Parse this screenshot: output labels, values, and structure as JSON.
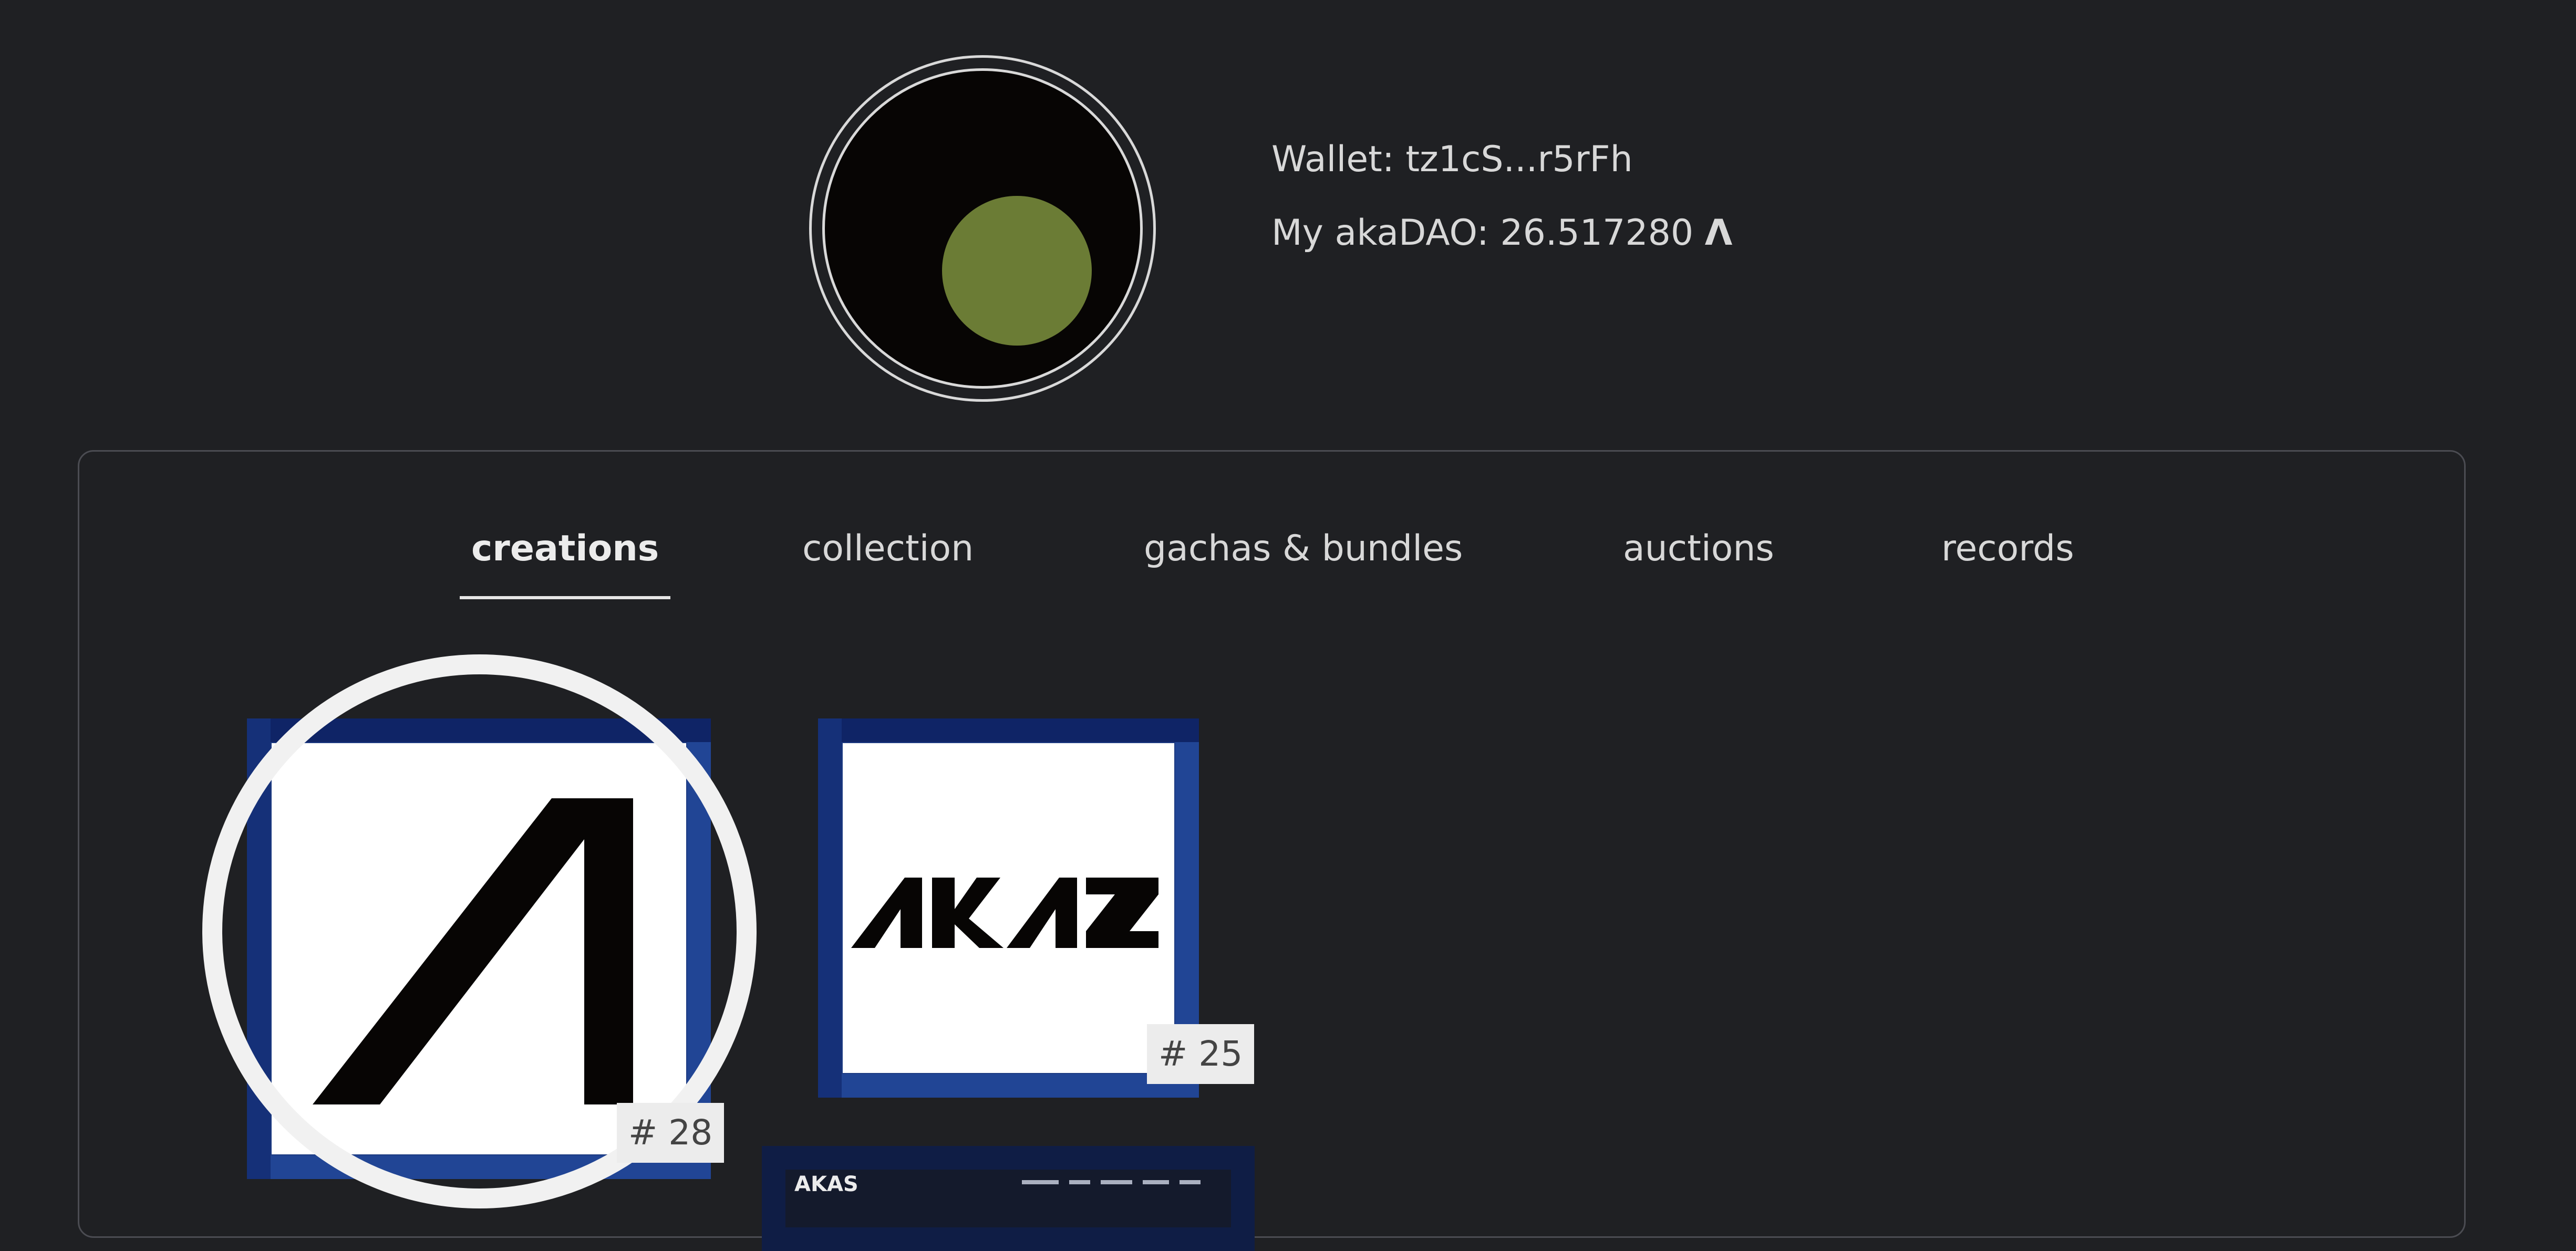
{
  "profile": {
    "wallet_label": "Wallet: tz1cS...r5rFh",
    "dao_label": "My akaDAO: 26.517280",
    "dao_symbol": "Λ"
  },
  "tabs": [
    {
      "label": "creations",
      "active": true
    },
    {
      "label": "collection",
      "active": false
    },
    {
      "label": "gachas & bundles",
      "active": false
    },
    {
      "label": "auctions",
      "active": false
    },
    {
      "label": "records",
      "active": false
    }
  ],
  "items": [
    {
      "badge": "# 28",
      "icon": "aka-lambda-logo-icon"
    },
    {
      "badge": "# 25",
      "icon": "akas-wordmark-icon"
    },
    {
      "icon": "page-preview-thumbnail",
      "logo": "AKAS"
    }
  ],
  "colors": {
    "background": "#1f2023",
    "card_border": "#214595",
    "avatar_dot": "#6b7c35"
  }
}
